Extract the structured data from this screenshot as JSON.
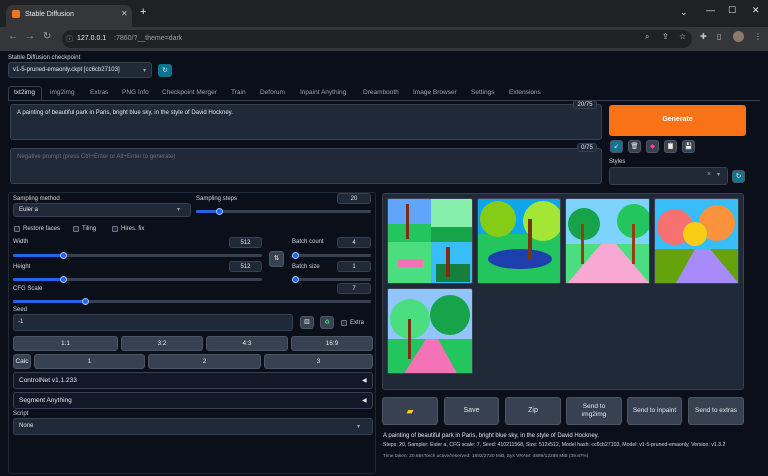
{
  "browser": {
    "tab_title": "Stable Diffusion",
    "url_host": "127.0.0.1",
    "url_path": ":7860/?__theme=dark"
  },
  "checkpoint": {
    "label": "Stable Diffusion checkpoint",
    "value": "v1-5-pruned-emaonly.ckpt [cc6cb27103]"
  },
  "tabs": [
    "txt2img",
    "img2img",
    "Extras",
    "PNG Info",
    "Checkpoint Merger",
    "Train",
    "Deforum",
    "Inpaint Anything",
    "Dreambooth",
    "Image Browser",
    "Settings",
    "Extensions"
  ],
  "prompt": {
    "positive": "A painting of beautiful park in Paris, bright blue sky, in the style of David Hockney.",
    "positive_count": "20/75",
    "negative_placeholder": "Negative prompt (press Ctrl+Enter or Alt+Enter to generate)",
    "negative_count": "0/75"
  },
  "generate_label": "Generate",
  "styles_label": "Styles",
  "styles_clear": "×",
  "sampling": {
    "method_label": "Sampling method",
    "method_value": "Euler a",
    "steps_label": "Sampling steps",
    "steps_value": "20",
    "steps_fraction": 0.13
  },
  "checks": {
    "restore_faces": "Restore faces",
    "tiling": "Tiling",
    "hires_fix": "Hires. fix"
  },
  "width": {
    "label": "Width",
    "value": "512",
    "fraction": 0.2
  },
  "height": {
    "label": "Height",
    "value": "512",
    "fraction": 0.2
  },
  "batch_count": {
    "label": "Batch count",
    "value": "4",
    "fraction": 0.03
  },
  "batch_size": {
    "label": "Batch size",
    "value": "1",
    "fraction": 0.0
  },
  "cfg": {
    "label": "CFG Scale",
    "value": "7",
    "fraction": 0.2
  },
  "seed": {
    "label": "Seed",
    "value": "-1",
    "extra_label": "Extra"
  },
  "aspect_buttons": [
    "1:1",
    "3:2",
    "4:3",
    "16:9"
  ],
  "calc_label": "Calc",
  "number_buttons": [
    "1",
    "2",
    "3"
  ],
  "controlnet_label": "ControlNet v1.1.233",
  "segment_label": "Segment Anything",
  "script": {
    "label": "Script",
    "value": "None"
  },
  "actions": {
    "folder": "folder-icon",
    "save": "Save",
    "zip": "Zip",
    "send_img2img": "Send to img2img",
    "send_inpaint": "Send to inpaint",
    "send_extras": "Send to extras"
  },
  "info": {
    "prompt": "A painting of beautiful park in Paris, bright blue sky, in the style of David Hockney.",
    "params": "Steps: 20, Sampler: Euler a, CFG scale: 7, Seed: 410211568, Size: 512x512, Model hash: cc6cb27103, Model: v1-5-pruned-emaonly, Version: v1.3.2",
    "time": "Time taken: 20.66sTorch active/reserved: 1882/2720 MiB, Sys VRAM: 4889/12288 MiB (39.87%)"
  },
  "colors": {
    "accent": "#f97316",
    "slider": "#2563eb",
    "bg": "#0b0f19"
  }
}
